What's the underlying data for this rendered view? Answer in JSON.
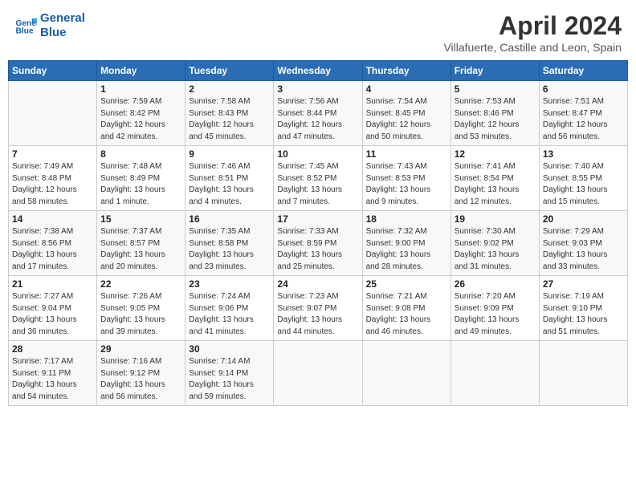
{
  "header": {
    "logo_line1": "General",
    "logo_line2": "Blue",
    "title": "April 2024",
    "subtitle": "Villafuerte, Castille and Leon, Spain"
  },
  "weekdays": [
    "Sunday",
    "Monday",
    "Tuesday",
    "Wednesday",
    "Thursday",
    "Friday",
    "Saturday"
  ],
  "weeks": [
    [
      {
        "day": "",
        "info": ""
      },
      {
        "day": "1",
        "info": "Sunrise: 7:59 AM\nSunset: 8:42 PM\nDaylight: 12 hours\nand 42 minutes."
      },
      {
        "day": "2",
        "info": "Sunrise: 7:58 AM\nSunset: 8:43 PM\nDaylight: 12 hours\nand 45 minutes."
      },
      {
        "day": "3",
        "info": "Sunrise: 7:56 AM\nSunset: 8:44 PM\nDaylight: 12 hours\nand 47 minutes."
      },
      {
        "day": "4",
        "info": "Sunrise: 7:54 AM\nSunset: 8:45 PM\nDaylight: 12 hours\nand 50 minutes."
      },
      {
        "day": "5",
        "info": "Sunrise: 7:53 AM\nSunset: 8:46 PM\nDaylight: 12 hours\nand 53 minutes."
      },
      {
        "day": "6",
        "info": "Sunrise: 7:51 AM\nSunset: 8:47 PM\nDaylight: 12 hours\nand 56 minutes."
      }
    ],
    [
      {
        "day": "7",
        "info": "Sunrise: 7:49 AM\nSunset: 8:48 PM\nDaylight: 12 hours\nand 58 minutes."
      },
      {
        "day": "8",
        "info": "Sunrise: 7:48 AM\nSunset: 8:49 PM\nDaylight: 13 hours\nand 1 minute."
      },
      {
        "day": "9",
        "info": "Sunrise: 7:46 AM\nSunset: 8:51 PM\nDaylight: 13 hours\nand 4 minutes."
      },
      {
        "day": "10",
        "info": "Sunrise: 7:45 AM\nSunset: 8:52 PM\nDaylight: 13 hours\nand 7 minutes."
      },
      {
        "day": "11",
        "info": "Sunrise: 7:43 AM\nSunset: 8:53 PM\nDaylight: 13 hours\nand 9 minutes."
      },
      {
        "day": "12",
        "info": "Sunrise: 7:41 AM\nSunset: 8:54 PM\nDaylight: 13 hours\nand 12 minutes."
      },
      {
        "day": "13",
        "info": "Sunrise: 7:40 AM\nSunset: 8:55 PM\nDaylight: 13 hours\nand 15 minutes."
      }
    ],
    [
      {
        "day": "14",
        "info": "Sunrise: 7:38 AM\nSunset: 8:56 PM\nDaylight: 13 hours\nand 17 minutes."
      },
      {
        "day": "15",
        "info": "Sunrise: 7:37 AM\nSunset: 8:57 PM\nDaylight: 13 hours\nand 20 minutes."
      },
      {
        "day": "16",
        "info": "Sunrise: 7:35 AM\nSunset: 8:58 PM\nDaylight: 13 hours\nand 23 minutes."
      },
      {
        "day": "17",
        "info": "Sunrise: 7:33 AM\nSunset: 8:59 PM\nDaylight: 13 hours\nand 25 minutes."
      },
      {
        "day": "18",
        "info": "Sunrise: 7:32 AM\nSunset: 9:00 PM\nDaylight: 13 hours\nand 28 minutes."
      },
      {
        "day": "19",
        "info": "Sunrise: 7:30 AM\nSunset: 9:02 PM\nDaylight: 13 hours\nand 31 minutes."
      },
      {
        "day": "20",
        "info": "Sunrise: 7:29 AM\nSunset: 9:03 PM\nDaylight: 13 hours\nand 33 minutes."
      }
    ],
    [
      {
        "day": "21",
        "info": "Sunrise: 7:27 AM\nSunset: 9:04 PM\nDaylight: 13 hours\nand 36 minutes."
      },
      {
        "day": "22",
        "info": "Sunrise: 7:26 AM\nSunset: 9:05 PM\nDaylight: 13 hours\nand 39 minutes."
      },
      {
        "day": "23",
        "info": "Sunrise: 7:24 AM\nSunset: 9:06 PM\nDaylight: 13 hours\nand 41 minutes."
      },
      {
        "day": "24",
        "info": "Sunrise: 7:23 AM\nSunset: 9:07 PM\nDaylight: 13 hours\nand 44 minutes."
      },
      {
        "day": "25",
        "info": "Sunrise: 7:21 AM\nSunset: 9:08 PM\nDaylight: 13 hours\nand 46 minutes."
      },
      {
        "day": "26",
        "info": "Sunrise: 7:20 AM\nSunset: 9:09 PM\nDaylight: 13 hours\nand 49 minutes."
      },
      {
        "day": "27",
        "info": "Sunrise: 7:19 AM\nSunset: 9:10 PM\nDaylight: 13 hours\nand 51 minutes."
      }
    ],
    [
      {
        "day": "28",
        "info": "Sunrise: 7:17 AM\nSunset: 9:11 PM\nDaylight: 13 hours\nand 54 minutes."
      },
      {
        "day": "29",
        "info": "Sunrise: 7:16 AM\nSunset: 9:12 PM\nDaylight: 13 hours\nand 56 minutes."
      },
      {
        "day": "30",
        "info": "Sunrise: 7:14 AM\nSunset: 9:14 PM\nDaylight: 13 hours\nand 59 minutes."
      },
      {
        "day": "",
        "info": ""
      },
      {
        "day": "",
        "info": ""
      },
      {
        "day": "",
        "info": ""
      },
      {
        "day": "",
        "info": ""
      }
    ]
  ]
}
